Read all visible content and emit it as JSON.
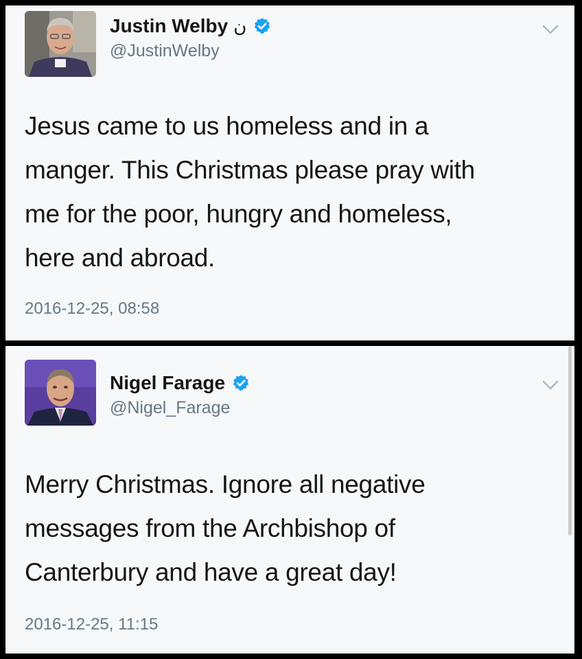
{
  "tweets": [
    {
      "author_name": "Justin Welby",
      "name_symbol": "ن",
      "handle": "@JustinWelby",
      "text_lines": [
        "Jesus came to us homeless and in a",
        "manger. This Christmas please pray with",
        "me for the poor, hungry and homeless,",
        "here and abroad."
      ],
      "timestamp": "2016-12-25, 08:58",
      "verified": true,
      "avatar": "bishop-portrait"
    },
    {
      "author_name": "Nigel Farage",
      "handle": "@Nigel_Farage",
      "text_lines": [
        "Merry Christmas. Ignore all negative",
        "messages from the Archbishop of",
        "Canterbury and have a great day!"
      ],
      "timestamp": "2016-12-25, 11:15",
      "verified": true,
      "avatar": "man-portrait-purple-background"
    }
  ],
  "icons": {
    "verified": "verified-badge-icon",
    "menu": "chevron-down-icon"
  },
  "colors": {
    "verified_blue": "#1da1f2",
    "text_primary": "#14171a",
    "text_secondary": "#657786",
    "card_background": "#f6f8fa",
    "frame": "#000000"
  }
}
